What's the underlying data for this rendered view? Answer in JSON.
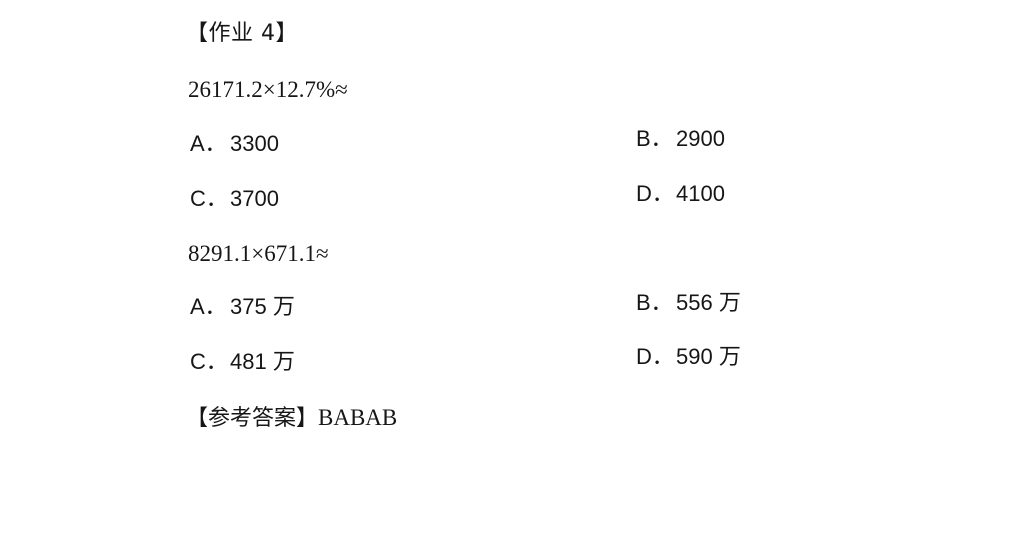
{
  "homework_heading": "【作业 4】",
  "questions": [
    {
      "expression": "26171.2×12.7%≈",
      "options": [
        {
          "letter": "A．",
          "value": "3300"
        },
        {
          "letter": "B．",
          "value": "2900"
        },
        {
          "letter": "C．",
          "value": "3700"
        },
        {
          "letter": "D．",
          "value": "4100"
        }
      ]
    },
    {
      "expression": "8291.1×671.1≈",
      "options": [
        {
          "letter": "A．",
          "value": "375 万"
        },
        {
          "letter": "B．",
          "value": "556 万"
        },
        {
          "letter": "C．",
          "value": "481 万"
        },
        {
          "letter": "D．",
          "value": "590 万"
        }
      ]
    }
  ],
  "answer": {
    "label": "【参考答案】",
    "value": "BABAB"
  }
}
